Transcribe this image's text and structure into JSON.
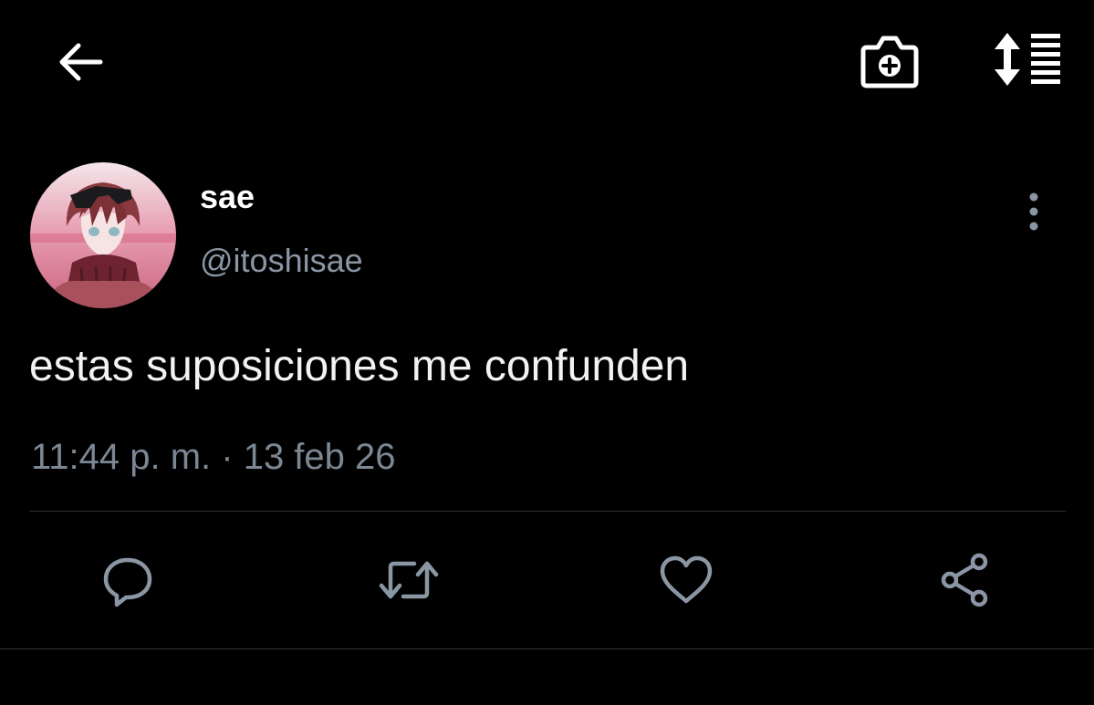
{
  "colors": {
    "background": "#000000",
    "text_primary": "#ffffff",
    "text_secondary": "#8a96a3",
    "timestamp": "#7c8794",
    "icon": "#8a96a3",
    "divider": "#2b2f33"
  },
  "topbar": {
    "back_icon": "arrow-left-icon",
    "camera_icon": "camera-plus-icon",
    "sort_icon": "sort-list-icon"
  },
  "tweet": {
    "author": {
      "display_name": "sae",
      "handle": "@itoshisae",
      "avatar_icon": "avatar-anime-character"
    },
    "text": "estas suposiciones me confunden",
    "timestamp": "11:44 p. m. · 13 feb 26",
    "more_icon": "vertical-dots-icon"
  },
  "actions": [
    {
      "name": "reply",
      "icon": "comment-bubble-icon"
    },
    {
      "name": "retweet",
      "icon": "retweet-icon"
    },
    {
      "name": "like",
      "icon": "heart-icon"
    },
    {
      "name": "share",
      "icon": "share-icon"
    }
  ]
}
